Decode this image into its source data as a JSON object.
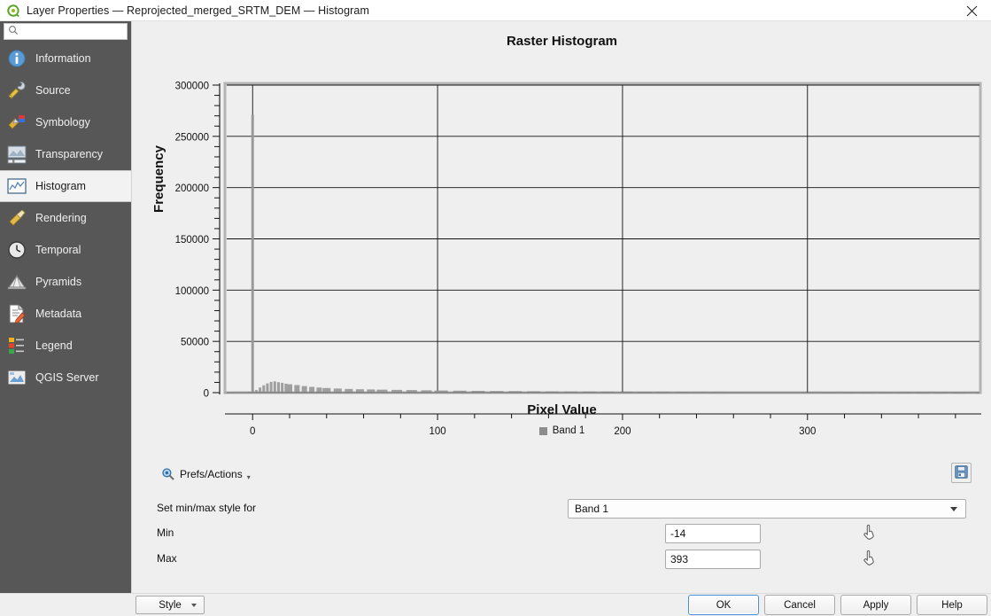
{
  "window": {
    "title": "Layer Properties — Reprojected_merged_SRTM_DEM — Histogram",
    "close_label": "✕",
    "logo_icon": "qgis-logo-icon"
  },
  "sidebar": {
    "search": {
      "value": "",
      "placeholder": "",
      "icon": "search-icon"
    },
    "items": [
      {
        "label": "Information",
        "icon": "information-icon",
        "selected": false
      },
      {
        "label": "Source",
        "icon": "source-icon",
        "selected": false
      },
      {
        "label": "Symbology",
        "icon": "symbology-icon",
        "selected": false
      },
      {
        "label": "Transparency",
        "icon": "transparency-icon",
        "selected": false
      },
      {
        "label": "Histogram",
        "icon": "histogram-icon",
        "selected": true
      },
      {
        "label": "Rendering",
        "icon": "rendering-icon",
        "selected": false
      },
      {
        "label": "Temporal",
        "icon": "temporal-icon",
        "selected": false
      },
      {
        "label": "Pyramids",
        "icon": "pyramids-icon",
        "selected": false
      },
      {
        "label": "Metadata",
        "icon": "metadata-icon",
        "selected": false
      },
      {
        "label": "Legend",
        "icon": "legend-icon",
        "selected": false
      },
      {
        "label": "QGIS Server",
        "icon": "qgis-server-icon",
        "selected": false
      }
    ]
  },
  "chart_data": {
    "type": "bar",
    "title": "Raster Histogram",
    "xlabel": "Pixel Value",
    "ylabel": "Frequency",
    "xlim": [
      -14,
      393
    ],
    "ylim": [
      0,
      300000
    ],
    "xticks": [
      0,
      100,
      200,
      300
    ],
    "yticks": [
      0,
      50000,
      100000,
      150000,
      200000,
      250000,
      300000
    ],
    "grid": true,
    "legend": [
      {
        "name": "Band 1",
        "color": "#8c8c8c"
      }
    ],
    "legend_position": "bottom-center",
    "bar_color": "#9a9a9a",
    "x": [
      -14,
      -10,
      -6,
      -2,
      0,
      2,
      4,
      6,
      8,
      10,
      12,
      14,
      16,
      18,
      20,
      24,
      28,
      32,
      36,
      40,
      46,
      52,
      58,
      64,
      70,
      78,
      86,
      94,
      102,
      112,
      122,
      132,
      142,
      152,
      162,
      172,
      182,
      192,
      202,
      212,
      222,
      232,
      242,
      252,
      262,
      272,
      282,
      292,
      302,
      312,
      322,
      332,
      342,
      352,
      362,
      372,
      382,
      392
    ],
    "values": [
      200,
      300,
      400,
      900,
      271000,
      2500,
      5000,
      7200,
      9000,
      10500,
      11000,
      10200,
      9600,
      8800,
      8200,
      7400,
      6400,
      5600,
      5000,
      4500,
      4000,
      3600,
      3300,
      3100,
      2900,
      2700,
      2500,
      2300,
      2100,
      1900,
      1750,
      1600,
      1500,
      1400,
      1300,
      1200,
      1100,
      1000,
      900,
      820,
      760,
      700,
      640,
      580,
      520,
      470,
      420,
      380,
      340,
      300,
      260,
      230,
      200,
      180,
      150,
      130,
      110,
      90
    ]
  },
  "controls": {
    "prefs_actions": {
      "label": "Prefs/Actions",
      "icon": "magnifier-prefs-icon",
      "arrow": "▾"
    },
    "save": {
      "icon": "save-floppy-icon",
      "tooltip": ""
    },
    "minmax_style_label": "Set min/max style for",
    "band_combo": {
      "value": "Band 1",
      "options": [
        "Band 1"
      ]
    },
    "min": {
      "label": "Min",
      "value": "-14",
      "picker_icon": "pointer-hand-icon"
    },
    "max": {
      "label": "Max",
      "value": "393",
      "picker_icon": "pointer-hand-icon"
    }
  },
  "bottom_bar": {
    "style_label": "Style",
    "ok_label": "OK",
    "cancel_label": "Cancel",
    "apply_label": "Apply",
    "help_label": "Help"
  }
}
